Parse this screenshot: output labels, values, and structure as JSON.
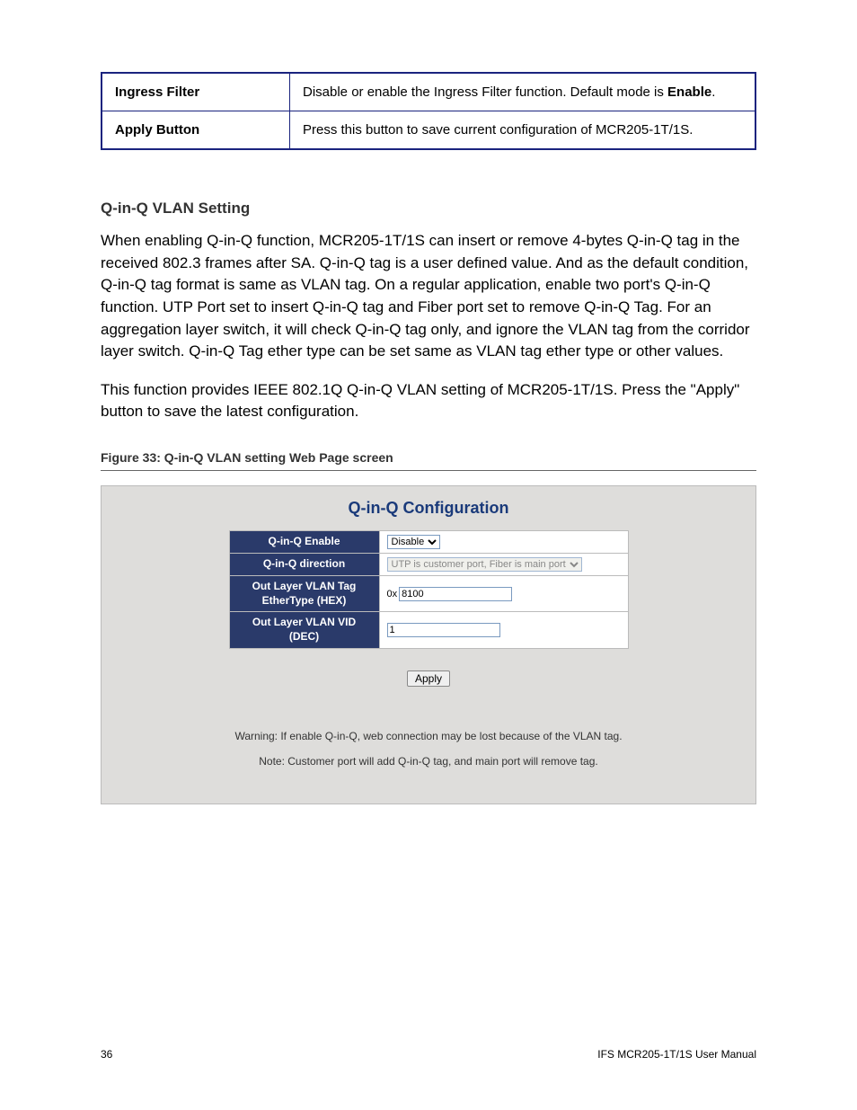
{
  "param_table": {
    "rows": [
      {
        "label": "Ingress Filter",
        "desc_prefix": "Disable or enable the Ingress Filter function. Default mode is ",
        "desc_bold": "Enable",
        "desc_suffix": "."
      },
      {
        "label": "Apply Button",
        "desc_prefix": "Press this button to save current configuration of MCR205-1T/1S.",
        "desc_bold": "",
        "desc_suffix": ""
      }
    ]
  },
  "section_heading": "Q-in-Q VLAN Setting",
  "paragraph1": "When enabling Q-in-Q function, MCR205-1T/1S can insert or remove 4-bytes Q-in-Q tag in the received 802.3 frames after SA. Q-in-Q tag is a user defined value. And as the default condition, Q-in-Q tag format is same as VLAN tag. On a regular application, enable two port's Q-in-Q function. UTP Port set to insert Q-in-Q tag and Fiber port set to remove Q-in-Q Tag. For an aggregation layer switch, it will check Q-in-Q tag only, and ignore the VLAN tag from the corridor layer switch. Q-in-Q Tag ether type can be set same as VLAN tag ether type or other values.",
  "paragraph2": "This function provides IEEE 802.1Q Q-in-Q VLAN setting of MCR205-1T/1S. Press the \"Apply\" button to save the latest configuration.",
  "figure_caption": "Figure 33: Q-in-Q VLAN setting Web Page screen",
  "screenshot": {
    "title": "Q-in-Q Configuration",
    "rows": {
      "enable": {
        "label": "Q-in-Q Enable",
        "value": "Disable"
      },
      "direction": {
        "label": "Q-in-Q direction",
        "value": "UTP is customer port, Fiber is main port"
      },
      "ethertype": {
        "label": "Out Layer VLAN Tag EtherType (HEX)",
        "prefix": "0x",
        "value": "8100"
      },
      "vid": {
        "label": "Out Layer VLAN VID (DEC)",
        "value": "1"
      }
    },
    "apply_label": "Apply",
    "warning": "Warning: If enable Q-in-Q, web connection may be lost because of the VLAN tag.",
    "note": "Note: Customer port will add Q-in-Q tag, and main port will remove tag."
  },
  "footer": {
    "page": "36",
    "manual": "IFS MCR205-1T/1S User Manual"
  }
}
